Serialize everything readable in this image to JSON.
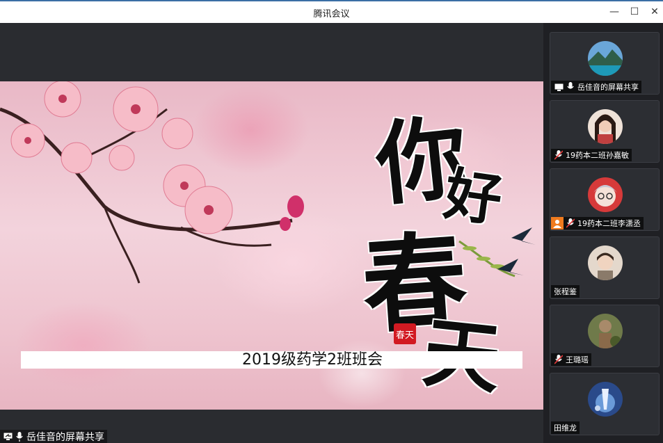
{
  "window": {
    "title": "腾讯会议",
    "minimize_glyph": "—",
    "maximize_glyph": "☐",
    "close_glyph": "✕"
  },
  "slide": {
    "calligraphy": [
      "你",
      "好",
      "春",
      "天"
    ],
    "seal_text": "春天",
    "subtitle": "2019级药学2班班会"
  },
  "share_label": {
    "text": "岳佳音的屏幕共享",
    "icons": [
      "screen-share-icon",
      "mic-icon"
    ]
  },
  "participants": [
    {
      "name": "岳佳音的屏幕共享",
      "icons": [
        "screen-share-icon",
        "mic-icon"
      ],
      "avatar_color": "#3f7fb5"
    },
    {
      "name": "19药本二班孙嘉敏",
      "icons": [
        "mic-muted-icon"
      ],
      "avatar_color": "#e8d0c4"
    },
    {
      "name": "19药本二班李潇丞",
      "icons": [
        "host-icon",
        "mic-muted-icon"
      ],
      "avatar_color": "#d63a3a"
    },
    {
      "name": "张程鉴",
      "icons": [],
      "avatar_color": "#d8c8bc"
    },
    {
      "name": "王璐瑶",
      "icons": [
        "mic-muted-icon"
      ],
      "avatar_color": "#6f7a4a"
    },
    {
      "name": "田维龙",
      "icons": [],
      "avatar_color": "#4a78c0"
    }
  ],
  "colors": {
    "accent": "#3a6ea5",
    "host_badge": "#f07b1e",
    "panel_bg": "#1f2024",
    "tile_bg": "#2c2e33"
  }
}
